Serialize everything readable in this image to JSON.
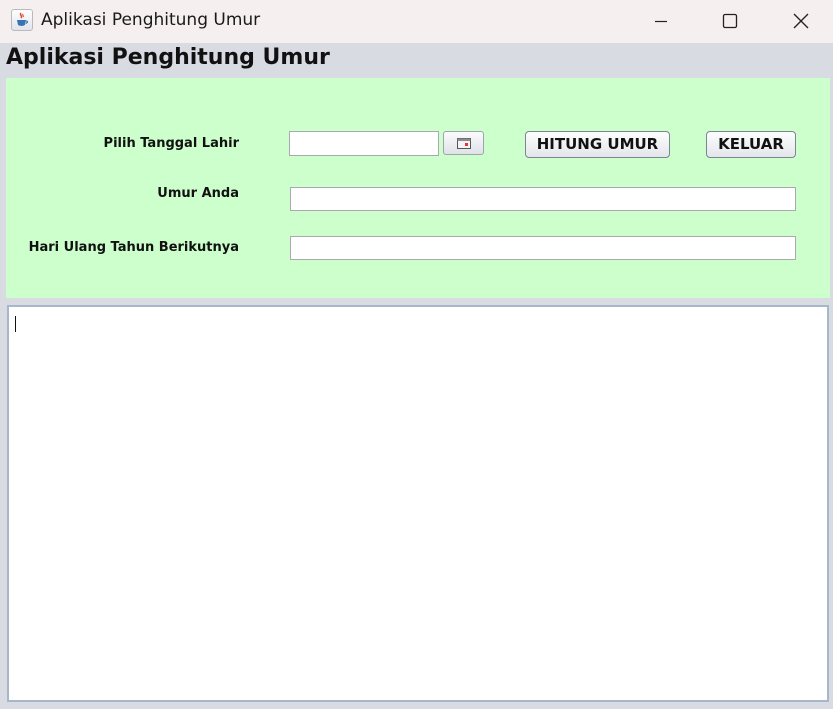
{
  "window": {
    "title": "Aplikasi Penghitung Umur",
    "icon": "java-coffee-cup-icon",
    "controls": [
      "minimize-icon",
      "maximize-icon",
      "close-icon"
    ]
  },
  "header": {
    "title": "Aplikasi Penghitung Umur"
  },
  "form": {
    "background_color": "#ccffcc",
    "birthdate_label": "Pilih Tanggal Lahir",
    "birthdate_value": "",
    "calendar_button_icon": "calendar-icon",
    "calculate_button_label": "HITUNG UMUR",
    "exit_button_label": "KELUAR",
    "age_label": "Umur Anda",
    "age_value": "",
    "next_birthday_label": "Hari Ulang Tahun Berikutnya",
    "next_birthday_value": ""
  },
  "output": {
    "text": ""
  }
}
